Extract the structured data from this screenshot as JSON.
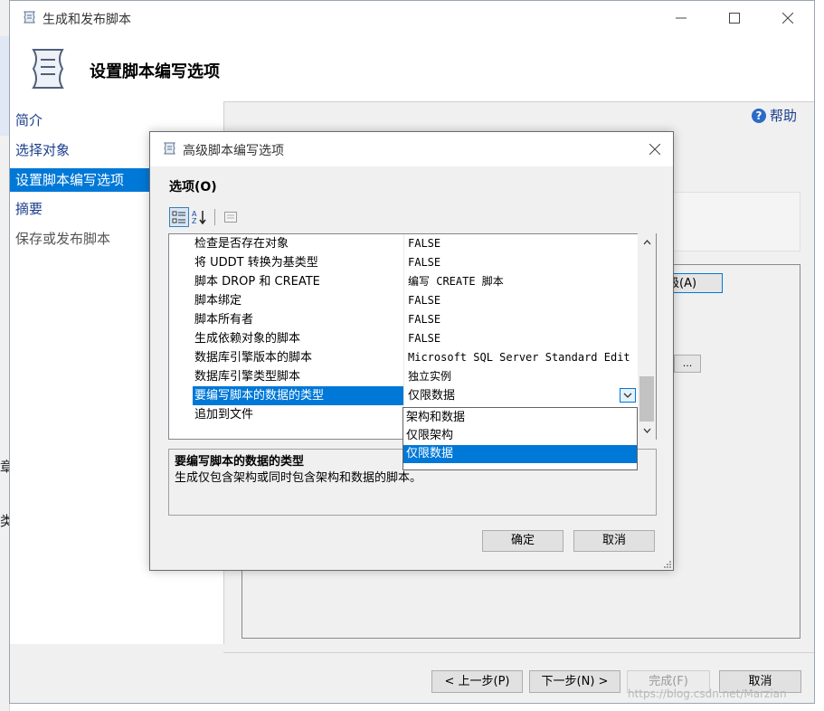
{
  "wizard": {
    "title": "生成和发布脚本",
    "header_title": "设置脚本编写选项",
    "nav": [
      {
        "label": "简介",
        "state": "link"
      },
      {
        "label": "选择对象",
        "state": "link"
      },
      {
        "label": "设置脚本编写选项",
        "state": "selected"
      },
      {
        "label": "摘要",
        "state": "link"
      },
      {
        "label": "保存或发布脚本",
        "state": "disabled"
      }
    ],
    "help_label": "帮助",
    "advanced_label": "级(A)",
    "ellipsis_label": "...",
    "buttons": {
      "prev": "< 上一步(P)",
      "next": "下一步(N) >",
      "finish": "完成(F)",
      "cancel": "取消"
    }
  },
  "background": {
    "char1": "章",
    "char2": "类"
  },
  "dialog": {
    "title": "高级脚本编写选项",
    "options_label": "选项(O)",
    "rows": [
      {
        "name": "检查是否存在对象",
        "value": "FALSE"
      },
      {
        "name": "将 UDDT 转换为基类型",
        "value": "FALSE"
      },
      {
        "name": "脚本 DROP 和 CREATE",
        "value": "编写 CREATE 脚本"
      },
      {
        "name": "脚本绑定",
        "value": "FALSE"
      },
      {
        "name": "脚本所有者",
        "value": "FALSE"
      },
      {
        "name": "生成依赖对象的脚本",
        "value": "FALSE"
      },
      {
        "name": "数据库引擎版本的脚本",
        "value": "Microsoft SQL Server Standard Edit"
      },
      {
        "name": "数据库引擎类型脚本",
        "value": "独立实例"
      },
      {
        "name": "要编写脚本的数据的类型",
        "value": "仅限数据"
      },
      {
        "name": "追加到文件",
        "value": ""
      }
    ],
    "dropdown_options": [
      "架构和数据",
      "仅限架构",
      "仅限数据"
    ],
    "dropdown_selected_index": 2,
    "description_title": "要编写脚本的数据的类型",
    "description_text": "生成仅包含架构或同时包含架构和数据的脚本。",
    "ok_label": "确定",
    "cancel_label": "取消"
  },
  "watermark": "https://blog.csdn.net/Marzian",
  "colors": {
    "accent": "#0078d7",
    "link": "#1a3e8c",
    "window_bg": "#f0f0f0"
  }
}
